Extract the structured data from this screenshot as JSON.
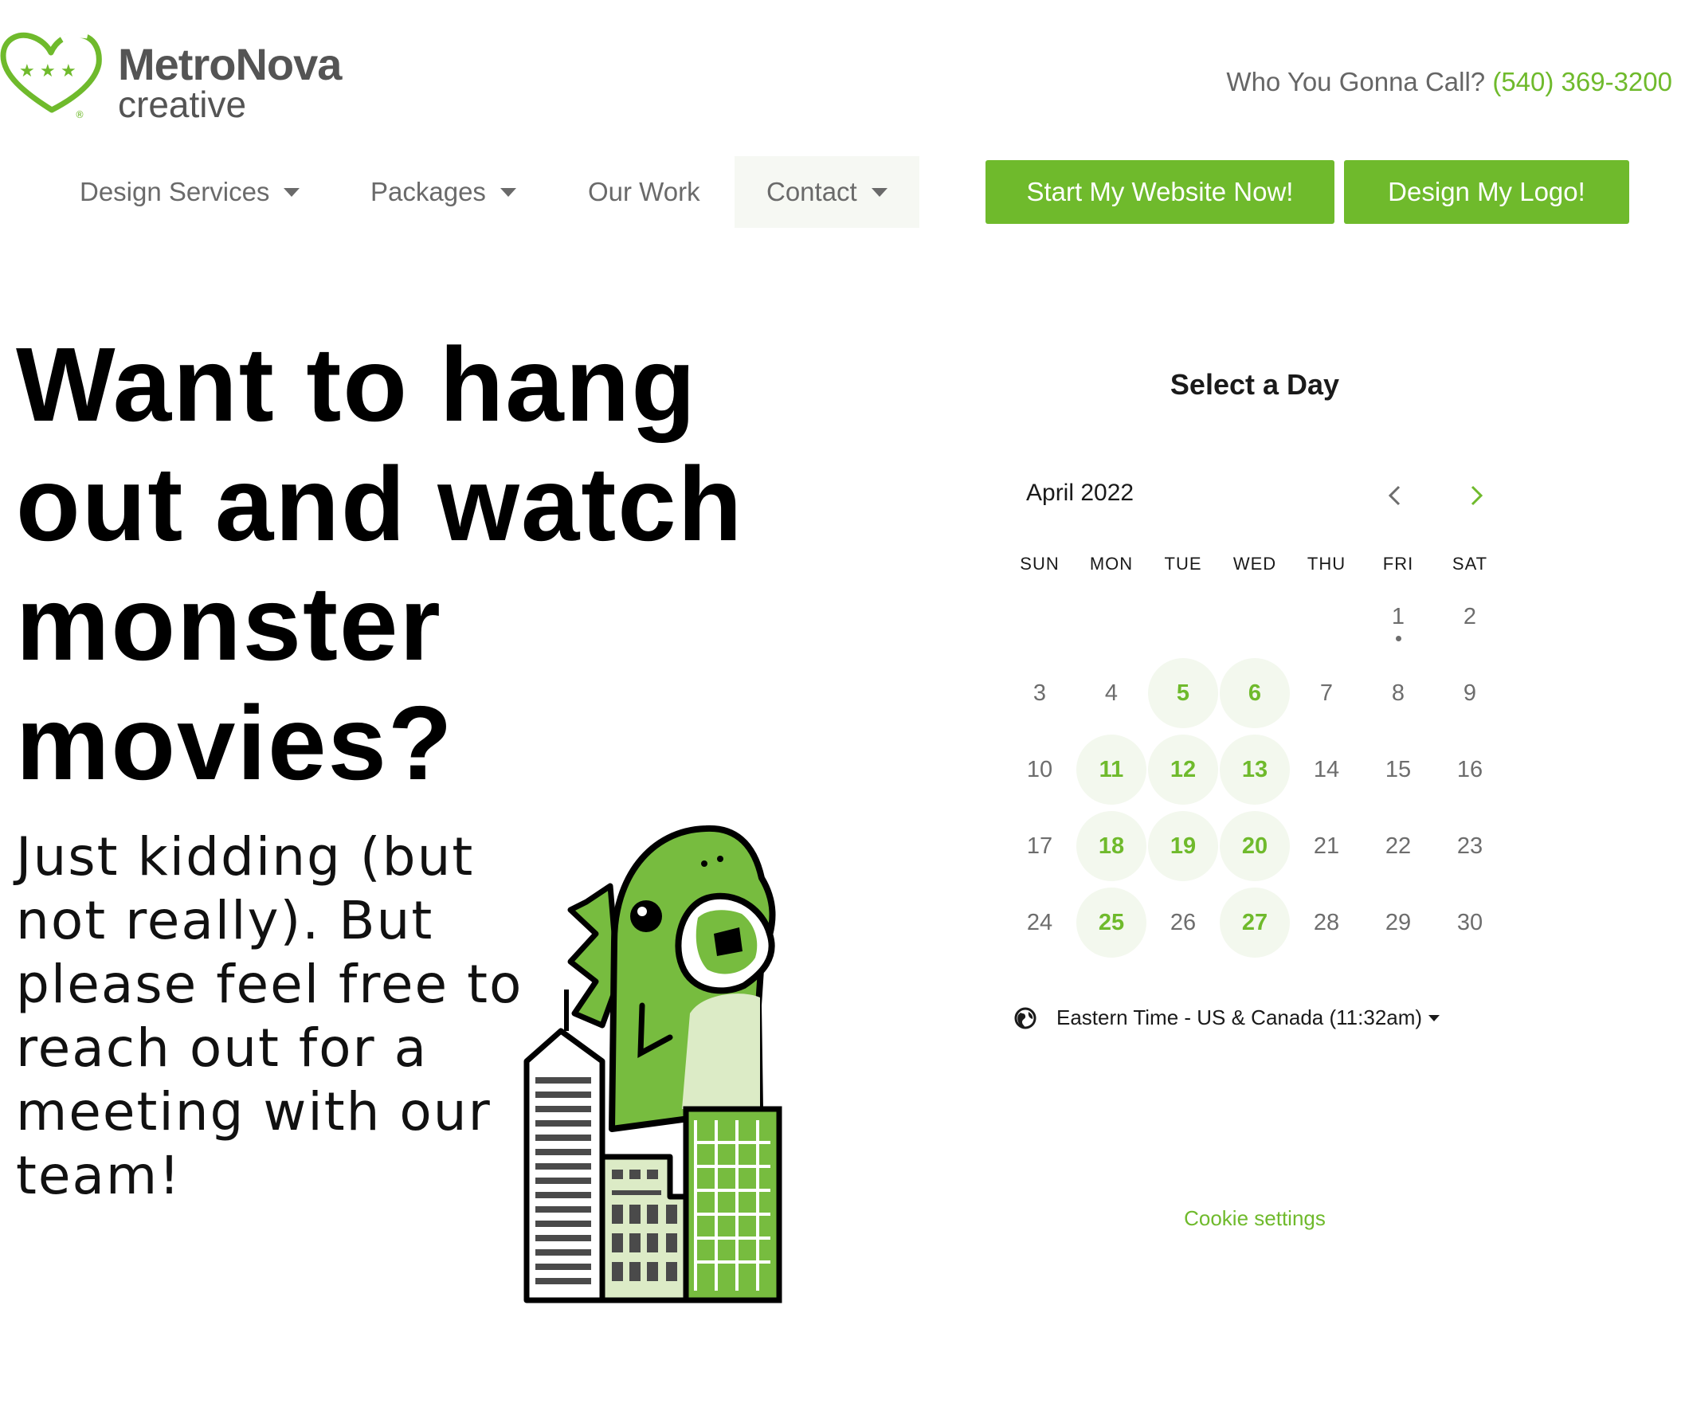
{
  "header": {
    "brand_name": "MetroNova",
    "brand_sub": "creative",
    "tagline": "Who You Gonna Call?",
    "phone": "(540) 369-3200"
  },
  "nav": {
    "items": [
      {
        "label": "Design Services",
        "dropdown": true
      },
      {
        "label": "Packages",
        "dropdown": true
      },
      {
        "label": "Our Work",
        "dropdown": false
      },
      {
        "label": "Contact",
        "dropdown": true
      }
    ],
    "cta_website": "Start My Website Now!",
    "cta_logo": "Design My Logo!"
  },
  "hero": {
    "title": "Want to hang out and watch monster movies?",
    "text": "Just kidding (but not really). But please feel free to reach out for a meeting with our team!"
  },
  "calendar": {
    "heading": "Select a Day",
    "month": "April 2022",
    "weekdays": [
      "SUN",
      "MON",
      "TUE",
      "WED",
      "THU",
      "FRI",
      "SAT"
    ],
    "weeks": [
      [
        null,
        null,
        null,
        null,
        null,
        "1",
        "2"
      ],
      [
        "3",
        "4",
        "5",
        "6",
        "7",
        "8",
        "9"
      ],
      [
        "10",
        "11",
        "12",
        "13",
        "14",
        "15",
        "16"
      ],
      [
        "17",
        "18",
        "19",
        "20",
        "21",
        "22",
        "23"
      ],
      [
        "24",
        "25",
        "26",
        "27",
        "28",
        "29",
        "30"
      ]
    ],
    "available": [
      "5",
      "6",
      "11",
      "12",
      "13",
      "18",
      "19",
      "20",
      "25",
      "27"
    ],
    "today": "1",
    "timezone": "Eastern Time - US & Canada (11:32am)",
    "cookie_label": "Cookie settings"
  },
  "colors": {
    "brand_green": "#6fba2c",
    "text_gray": "#6a6a6a",
    "available_bg": "#f3f8ee"
  }
}
